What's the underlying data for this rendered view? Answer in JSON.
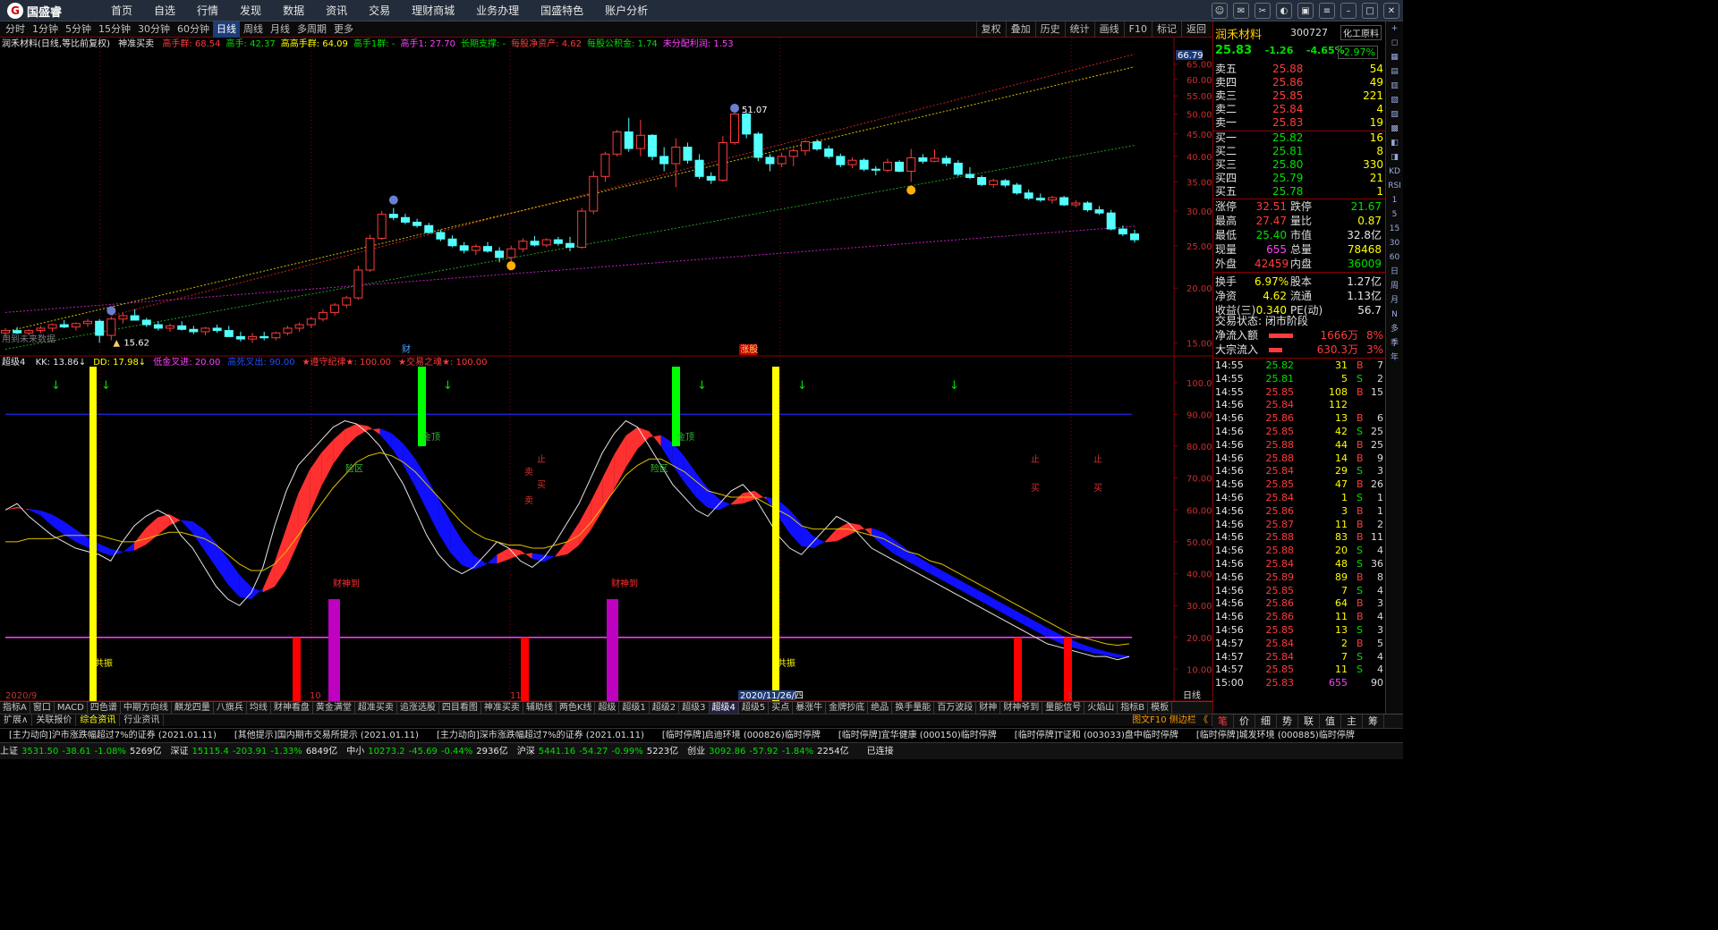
{
  "app": {
    "logo": "国盛睿"
  },
  "menu": [
    "首页",
    "自选",
    "行情",
    "发现",
    "数据",
    "资讯",
    "交易",
    "理财商城",
    "业务办理",
    "国盛特色",
    "账户分析"
  ],
  "periods": [
    "分时",
    "1分钟",
    "5分钟",
    "15分钟",
    "30分钟",
    "60分钟",
    "日线",
    "周线",
    "月线",
    "多周期",
    "更多"
  ],
  "active_period": "日线",
  "tools": [
    "复权",
    "叠加",
    "历史",
    "统计",
    "画线",
    "F10",
    "标记",
    "返回"
  ],
  "info": {
    "title": "润禾材料(日线,等比前复权)",
    "shenzhun": "神准买卖",
    "items": [
      {
        "t": "高手群: 68.54",
        "c": "#ff3c3c"
      },
      {
        "t": "高手: 42.37",
        "c": "#00e000"
      },
      {
        "t": "高高手群: 64.09",
        "c": "#ffff00"
      },
      {
        "t": "高手1群: -",
        "c": "#00e000"
      },
      {
        "t": "高手1: 27.70",
        "c": "#ff40ff"
      },
      {
        "t": "长期支撑: -",
        "c": "#00e000"
      },
      {
        "t": "每股净资产: 4.62",
        "c": "#ff3c3c"
      },
      {
        "t": "每股公积金: 1.74",
        "c": "#00e000"
      },
      {
        "t": "未分配利润: 1.53",
        "c": "#ff40ff"
      }
    ]
  },
  "ind_line": {
    "name": "超级4",
    "items": [
      {
        "t": "KK: 13.86↓",
        "c": "#e6e6e6"
      },
      {
        "t": "DD: 17.98↓",
        "c": "#ffff00"
      },
      {
        "t": "低金叉进: 20.00",
        "c": "#ff40ff"
      },
      {
        "t": "高死叉出: 90.00",
        "c": "#1e50ff"
      },
      {
        "t": "★遵守纪律★: 100.00",
        "c": "#ff3c3c"
      },
      {
        "t": "★交易之魂★: 100.00",
        "c": "#ff3c3c"
      }
    ]
  },
  "chart_data": {
    "type": "candlestick",
    "price_axis": [
      "65.00",
      "60.00",
      "55.00",
      "50.00",
      "45.00",
      "40.00",
      "35.00",
      "30.00",
      "25.00",
      "20.00",
      "15.00"
    ],
    "top_price_label": "66.79",
    "indicator_axis": [
      "100.0",
      "90.00",
      "80.00",
      "70.00",
      "60.00",
      "50.00",
      "40.00",
      "30.00",
      "20.00",
      "10.00"
    ],
    "date_labels": [
      "2020/9",
      "10",
      "11",
      "2020/11/26/四",
      "1"
    ],
    "axis_right_label": "日线",
    "annotations": {
      "high": "51.07",
      "low": "15.62",
      "mark_cai": "财",
      "mark_zhang": "涨",
      "mark_gu": "股",
      "legend_left": "用到未来数据"
    },
    "ind_texts": {
      "jingu": "金顶",
      "fanxian": "险区",
      "zhi": "止",
      "mai": "卖",
      "mai2": "买",
      "caishen": "财神到",
      "qizhen": "共振"
    },
    "candles": [
      [
        15.8,
        16.2,
        15.5,
        16.0
      ],
      [
        16.0,
        16.3,
        15.7,
        15.8
      ],
      [
        15.8,
        16.1,
        15.6,
        16.0
      ],
      [
        16.0,
        16.4,
        15.8,
        16.2
      ],
      [
        16.2,
        16.6,
        15.9,
        16.5
      ],
      [
        16.5,
        16.9,
        16.2,
        16.3
      ],
      [
        16.3,
        16.7,
        16.0,
        16.6
      ],
      [
        16.6,
        17.0,
        16.3,
        16.8
      ],
      [
        16.8,
        17.0,
        15.0,
        15.6
      ],
      [
        15.6,
        17.2,
        15.2,
        17.0
      ],
      [
        17.0,
        17.6,
        16.6,
        17.3
      ],
      [
        17.3,
        17.9,
        16.9,
        16.9
      ],
      [
        16.9,
        17.1,
        16.3,
        16.5
      ],
      [
        16.5,
        16.8,
        16.0,
        16.2
      ],
      [
        16.2,
        16.6,
        15.9,
        16.4
      ],
      [
        16.4,
        16.8,
        16.0,
        16.1
      ],
      [
        16.1,
        16.4,
        15.7,
        15.9
      ],
      [
        15.9,
        16.3,
        15.6,
        16.2
      ],
      [
        16.2,
        16.5,
        15.8,
        16.0
      ],
      [
        16.0,
        16.4,
        15.7,
        15.5
      ],
      [
        15.5,
        15.9,
        15.1,
        15.3
      ],
      [
        15.3,
        15.8,
        15.0,
        15.5
      ],
      [
        15.5,
        15.9,
        15.2,
        15.4
      ],
      [
        15.4,
        15.9,
        15.2,
        15.8
      ],
      [
        15.8,
        16.4,
        15.6,
        16.2
      ],
      [
        16.2,
        16.7,
        15.9,
        16.5
      ],
      [
        16.5,
        17.2,
        16.2,
        17.0
      ],
      [
        17.0,
        17.9,
        16.8,
        17.6
      ],
      [
        17.6,
        18.5,
        17.3,
        18.3
      ],
      [
        18.3,
        19.2,
        18.0,
        19.0
      ],
      [
        19.0,
        22.5,
        18.8,
        22.0
      ],
      [
        22.0,
        26.5,
        21.8,
        26.0
      ],
      [
        26.0,
        30.0,
        25.8,
        29.5
      ],
      [
        29.5,
        30.5,
        28.6,
        29.0
      ],
      [
        29.0,
        29.6,
        28.0,
        28.3
      ],
      [
        28.3,
        28.8,
        27.5,
        27.8
      ],
      [
        27.8,
        28.2,
        26.6,
        26.8
      ],
      [
        26.8,
        27.2,
        25.6,
        25.9
      ],
      [
        25.9,
        26.4,
        24.8,
        25.0
      ],
      [
        25.0,
        25.5,
        24.0,
        24.4
      ],
      [
        24.4,
        25.2,
        23.8,
        24.9
      ],
      [
        24.9,
        25.5,
        24.1,
        24.3
      ],
      [
        24.3,
        24.8,
        22.9,
        23.5
      ],
      [
        23.5,
        25.0,
        23.0,
        24.6
      ],
      [
        24.6,
        26.0,
        24.2,
        25.6
      ],
      [
        25.6,
        26.3,
        24.9,
        25.1
      ],
      [
        25.1,
        26.0,
        24.8,
        25.8
      ],
      [
        25.8,
        26.2,
        25.0,
        25.3
      ],
      [
        25.3,
        26.2,
        24.3,
        24.8
      ],
      [
        24.8,
        30.5,
        24.6,
        30.0
      ],
      [
        30.0,
        37.0,
        29.5,
        36.0
      ],
      [
        36.0,
        41.0,
        35.0,
        40.5
      ],
      [
        40.5,
        46.0,
        40.0,
        45.5
      ],
      [
        45.5,
        49.0,
        41.0,
        41.7
      ],
      [
        41.7,
        48.5,
        40.0,
        44.7
      ],
      [
        44.7,
        45.0,
        39.2,
        40.0
      ],
      [
        40.0,
        42.0,
        37.0,
        38.5
      ],
      [
        38.5,
        44.0,
        34.0,
        42.0
      ],
      [
        42.0,
        43.0,
        38.5,
        39.2
      ],
      [
        39.2,
        40.5,
        35.5,
        36.0
      ],
      [
        36.0,
        36.8,
        34.6,
        35.3
      ],
      [
        35.3,
        44.5,
        35.0,
        43.0
      ],
      [
        43.0,
        51.1,
        42.5,
        50.0
      ],
      [
        50.0,
        50.5,
        44.0,
        45.0
      ],
      [
        45.0,
        45.5,
        39.0,
        39.8
      ],
      [
        39.8,
        40.5,
        37.0,
        38.5
      ],
      [
        38.5,
        40.8,
        37.8,
        40.0
      ],
      [
        40.0,
        41.8,
        38.0,
        41.2
      ],
      [
        41.2,
        43.6,
        40.2,
        43.2
      ],
      [
        43.2,
        43.8,
        41.2,
        41.6
      ],
      [
        41.6,
        42.4,
        39.5,
        40.0
      ],
      [
        40.0,
        40.6,
        37.8,
        38.3
      ],
      [
        38.3,
        39.8,
        37.6,
        39.2
      ],
      [
        39.2,
        39.6,
        37.0,
        37.4
      ],
      [
        37.4,
        38.0,
        36.2,
        37.2
      ],
      [
        37.2,
        39.5,
        36.8,
        38.8
      ],
      [
        38.8,
        39.2,
        36.8,
        37.0
      ],
      [
        37.0,
        41.6,
        35.0,
        39.7
      ],
      [
        39.7,
        40.5,
        38.5,
        39.0
      ],
      [
        39.0,
        41.5,
        38.8,
        39.6
      ],
      [
        39.6,
        40.2,
        38.0,
        38.6
      ],
      [
        38.6,
        39.2,
        36.0,
        36.4
      ],
      [
        36.4,
        37.8,
        35.5,
        35.8
      ],
      [
        35.8,
        36.2,
        34.2,
        34.5
      ],
      [
        34.5,
        35.6,
        33.9,
        35.2
      ],
      [
        35.2,
        35.5,
        34.0,
        34.4
      ],
      [
        34.4,
        34.8,
        32.7,
        33.0
      ],
      [
        33.0,
        33.6,
        31.8,
        32.1
      ],
      [
        32.1,
        32.9,
        31.5,
        31.8
      ],
      [
        31.8,
        32.5,
        31.2,
        32.2
      ],
      [
        32.2,
        32.5,
        30.8,
        31.0
      ],
      [
        31.0,
        31.8,
        30.6,
        31.3
      ],
      [
        31.3,
        31.6,
        29.9,
        30.2
      ],
      [
        30.2,
        30.8,
        29.4,
        29.7
      ],
      [
        29.7,
        30.2,
        27.1,
        27.3
      ],
      [
        27.3,
        27.8,
        26.3,
        26.6
      ],
      [
        26.6,
        27.2,
        25.4,
        25.8
      ]
    ],
    "kk": [
      60,
      62,
      58,
      55,
      52,
      50,
      48,
      47,
      46,
      44,
      50,
      55,
      58,
      60,
      58,
      52,
      48,
      42,
      36,
      32,
      30,
      34,
      42,
      55,
      66,
      74,
      78,
      82,
      86,
      88,
      87,
      84,
      80,
      74,
      68,
      60,
      52,
      46,
      42,
      40,
      42,
      46,
      50,
      48,
      44,
      42,
      45,
      50,
      56,
      62,
      70,
      78,
      84,
      88,
      86,
      80,
      74,
      68,
      64,
      60,
      58,
      62,
      66,
      68,
      64,
      58,
      52,
      48,
      46,
      50,
      54,
      58,
      56,
      52,
      48,
      46,
      44,
      42,
      40,
      38,
      36,
      34,
      32,
      30,
      28,
      26,
      24,
      22,
      20,
      18,
      17,
      16,
      15,
      14,
      14,
      13,
      14
    ],
    "dd": [
      50,
      50,
      51,
      51,
      51,
      52,
      52,
      52,
      52,
      51,
      50,
      50,
      51,
      52,
      53,
      53,
      52,
      51,
      49,
      46,
      43,
      41,
      41,
      43,
      47,
      52,
      57,
      62,
      67,
      71,
      75,
      77,
      78,
      77,
      75,
      72,
      68,
      64,
      60,
      56,
      53,
      51,
      50,
      49,
      49,
      48,
      48,
      49,
      50,
      52,
      56,
      61,
      66,
      71,
      74,
      76,
      76,
      74,
      72,
      69,
      66,
      65,
      64,
      64,
      64,
      62,
      60,
      58,
      55,
      54,
      54,
      54,
      54,
      53,
      52,
      51,
      49,
      47,
      46,
      44,
      43,
      41,
      39,
      37,
      35,
      33,
      31,
      29,
      27,
      25,
      23,
      21,
      20,
      19,
      18,
      17.5,
      18
    ]
  },
  "right_panel": {
    "name": "润禾材料",
    "code": "300727",
    "industry": "化工原料",
    "price": "25.83",
    "change": "-1.26",
    "pct": "-4.65%",
    "ind_pct": "-2.97%",
    "asks": [
      {
        "l": "卖五",
        "p": "25.88",
        "v": "54"
      },
      {
        "l": "卖四",
        "p": "25.86",
        "v": "49"
      },
      {
        "l": "卖三",
        "p": "25.85",
        "v": "221"
      },
      {
        "l": "卖二",
        "p": "25.84",
        "v": "4"
      },
      {
        "l": "卖一",
        "p": "25.83",
        "v": "19"
      }
    ],
    "bids": [
      {
        "l": "买一",
        "p": "25.82",
        "v": "16"
      },
      {
        "l": "买二",
        "p": "25.81",
        "v": "8"
      },
      {
        "l": "买三",
        "p": "25.80",
        "v": "330"
      },
      {
        "l": "买四",
        "p": "25.79",
        "v": "21"
      },
      {
        "l": "买五",
        "p": "25.78",
        "v": "1"
      }
    ],
    "stats": [
      {
        "a": "涨停",
        "b": "32.51",
        "bc": "#ff3c3c",
        "c": "跌停",
        "d": "21.67",
        "dc": "#00e000"
      },
      {
        "a": "最高",
        "b": "27.47",
        "bc": "#ff3c3c",
        "c": "量比",
        "d": "0.87",
        "dc": "#ffff00"
      },
      {
        "a": "最低",
        "b": "25.40",
        "bc": "#00e000",
        "c": "市值",
        "d": "32.8亿",
        "dc": "#e6e6e6"
      },
      {
        "a": "现量",
        "b": "655",
        "bc": "#ff40ff",
        "c": "总量",
        "d": "78468",
        "dc": "#ffff00"
      },
      {
        "a": "外盘",
        "b": "42459",
        "bc": "#ff3c3c",
        "c": "内盘",
        "d": "36009",
        "dc": "#00e000"
      },
      {
        "a": "换手",
        "b": "6.97%",
        "bc": "#ffff00",
        "c": "股本",
        "d": "1.27亿",
        "dc": "#e6e6e6"
      },
      {
        "a": "净资",
        "b": "4.62",
        "bc": "#ffff00",
        "c": "流通",
        "d": "1.13亿",
        "dc": "#e6e6e6"
      },
      {
        "a": "收益(三)",
        "b": "0.340",
        "bc": "#ffff00",
        "c": "PE(动)",
        "d": "56.7",
        "dc": "#e6e6e6"
      }
    ],
    "status": "交易状态: 闭市阶段",
    "inflow": {
      "l": "净流入额",
      "v": "1666万",
      "p": "8%"
    },
    "block": {
      "l": "大宗流入",
      "v": "630.3万",
      "p": "3%"
    },
    "ticks": [
      [
        "14:55",
        "25.82",
        "31",
        "B",
        "7"
      ],
      [
        "14:55",
        "25.81",
        "5",
        "S",
        "2"
      ],
      [
        "14:55",
        "25.85",
        "108",
        "B",
        "15"
      ],
      [
        "14:56",
        "25.84",
        "112",
        "",
        ""
      ],
      [
        "14:56",
        "25.86",
        "13",
        "B",
        "6"
      ],
      [
        "14:56",
        "25.85",
        "42",
        "S",
        "25"
      ],
      [
        "14:56",
        "25.88",
        "44",
        "B",
        "25"
      ],
      [
        "14:56",
        "25.88",
        "14",
        "B",
        "9"
      ],
      [
        "14:56",
        "25.84",
        "29",
        "S",
        "3"
      ],
      [
        "14:56",
        "25.85",
        "47",
        "B",
        "26"
      ],
      [
        "14:56",
        "25.84",
        "1",
        "S",
        "1"
      ],
      [
        "14:56",
        "25.86",
        "3",
        "B",
        "1"
      ],
      [
        "14:56",
        "25.87",
        "11",
        "B",
        "2"
      ],
      [
        "14:56",
        "25.88",
        "83",
        "B",
        "11"
      ],
      [
        "14:56",
        "25.88",
        "20",
        "S",
        "4"
      ],
      [
        "14:56",
        "25.84",
        "48",
        "S",
        "36"
      ],
      [
        "14:56",
        "25.89",
        "89",
        "B",
        "8"
      ],
      [
        "14:56",
        "25.85",
        "7",
        "S",
        "4"
      ],
      [
        "14:56",
        "25.86",
        "64",
        "B",
        "3"
      ],
      [
        "14:56",
        "25.86",
        "11",
        "B",
        "4"
      ],
      [
        "14:56",
        "25.85",
        "13",
        "S",
        "3"
      ],
      [
        "14:57",
        "25.84",
        "2",
        "B",
        "5"
      ],
      [
        "14:57",
        "25.84",
        "7",
        "S",
        "4"
      ],
      [
        "14:57",
        "25.85",
        "11",
        "S",
        "4"
      ],
      [
        "15:00",
        "25.83",
        "655",
        "",
        "90"
      ]
    ]
  },
  "right_tabs": [
    "笔",
    "价",
    "细",
    "势",
    "联",
    "值",
    "主",
    "筹"
  ],
  "right_side": [
    "+",
    "◻",
    "▦",
    "▤",
    "▥",
    "▧",
    "▨",
    "▩",
    "◧",
    "◨",
    "KD",
    "RSI",
    "1",
    "5",
    "15",
    "30",
    "60",
    "日",
    "周",
    "月",
    "N",
    "多",
    "季",
    "年"
  ],
  "bottom_tabs1": [
    "指标A",
    "窗口",
    "MACD",
    "四色谱",
    "中期方向线",
    "麒龙四量",
    "八旗兵",
    "均线",
    "财神看盘",
    "黄金满堂",
    "超准买卖",
    "追涨选股",
    "四目看图",
    "神准买卖",
    "辅助线",
    "两色K线",
    "超级",
    "超级1",
    "超级2",
    "超级3",
    "超级4",
    "超级5",
    "买点",
    "暴涨牛",
    "金牌抄底",
    "绝品",
    "换手量能",
    "百万波段",
    "财神",
    "财神爷到",
    "量能信号",
    "火焰山",
    "指标B",
    "模板"
  ],
  "bottom_tabs1_active": "超级4",
  "bottom_tabs2": [
    "扩展∧",
    "关联报价",
    "综合资讯",
    "行业资讯"
  ],
  "bottom_tabs2_right": "图文F10 侧边栏 《",
  "news": [
    "[主力动向]沪市涨跌幅超过7%的证券 (2021.01.11)",
    "[其他提示]国内期市交易所提示 (2021.01.11)",
    "[主力动向]深市涨跌幅超过7%的证券 (2021.01.11)",
    "[临时停牌]启迪环境 (000826)临时停牌",
    "[临时停牌]宜华健康 (000150)临时停牌",
    "[临时停牌]T证和 (003033)盘中临时停牌",
    "[临时停牌]城发环境 (000885)临时停牌"
  ],
  "status": [
    {
      "n": "上证",
      "v": "3531.50",
      "c": "-38.61",
      "p": "-1.08%",
      "a": "5269亿"
    },
    {
      "n": "深证",
      "v": "15115.4",
      "c": "-203.91",
      "p": "-1.33%",
      "a": "6849亿"
    },
    {
      "n": "中小",
      "v": "10273.2",
      "c": "-45.69",
      "p": "-0.44%",
      "a": "2936亿"
    },
    {
      "n": "沪深",
      "v": "5441.16",
      "c": "-54.27",
      "p": "-0.99%",
      "a": "5223亿"
    },
    {
      "n": "创业",
      "v": "3092.86",
      "c": "-57.92",
      "p": "-1.84%",
      "a": "2254亿"
    }
  ],
  "connected": "已连接"
}
